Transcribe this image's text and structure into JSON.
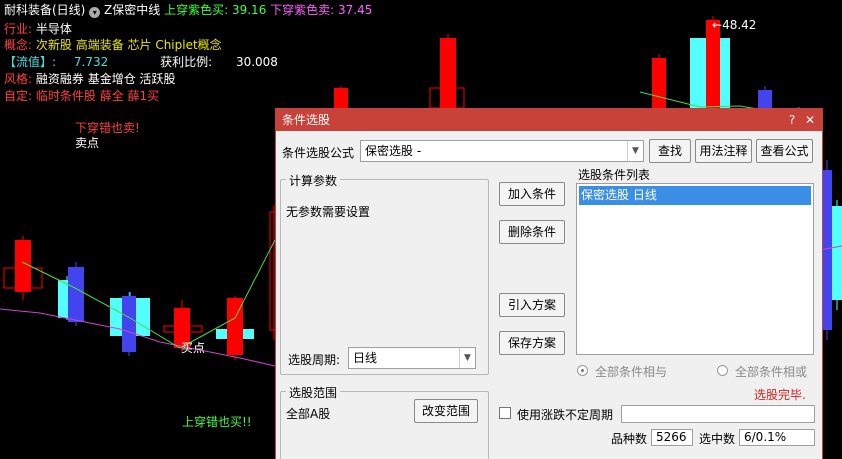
{
  "header": {
    "stock_name": "耐科装备(日线)",
    "indicator_icon": "dropdown-circle-icon",
    "indicator_name": "Z保密中线",
    "buy_label": "上穿紫色买:",
    "buy_value": "39.16",
    "sell_label": "下穿紫色卖:",
    "sell_value": "37.45"
  },
  "info": {
    "industry_label": "行业:",
    "industry_value": "半导体",
    "concept_label": "概念:",
    "concept_value": "次新股 高端装备 芯片 Chiplet概念",
    "float_label": "【流值】:",
    "float_value": "7.732",
    "profit_label": "获利比例:",
    "profit_value": "30.008",
    "style_label": "风格:",
    "style_value": "融资融券 基金增仓 活跃股",
    "custom_label": "自定:",
    "custom_value": "临时条件股 薛全 薛1买"
  },
  "chart_annotations": {
    "sell_signal_text": "下穿错也卖!",
    "sell_point_text": "卖点",
    "buy_point_text": "买点",
    "buy_signal_text": "上穿错也买!!",
    "high_price_label": "48.42"
  },
  "colors": {
    "up": "#ff0000",
    "down": "#54ffff",
    "purple_line": "#cc44cc",
    "green_line": "#44dd44",
    "dialog_title": "#c8423a",
    "selection": "#3a8ee6",
    "done_text": "#d42020"
  },
  "dialog": {
    "title": "条件选股",
    "help_icon": "question-icon",
    "close_icon": "close-icon",
    "formula_label": "条件选股公式",
    "formula_value": "保密选股 -",
    "find_button": "查找",
    "usage_button": "用法注释",
    "view_formula_button": "查看公式",
    "params_group_title": "计算参数",
    "params_text": "无参数需要设置",
    "period_label": "选股周期:",
    "period_value": "日线",
    "range_group_title": "选股范围",
    "range_value": "全部A股",
    "change_range_button": "改变范围",
    "add_condition_button": "加入条件",
    "delete_condition_button": "删除条件",
    "import_scheme_button": "引入方案",
    "save_scheme_button": "保存方案",
    "condition_list_label": "选股条件列表",
    "conditions": [
      "保密选股  日线"
    ],
    "radio_and": "全部条件相与",
    "radio_or": "全部条件相或",
    "done_text": "选股完毕.",
    "use_change_period_label": "使用涨跌不定周期",
    "stock_count_label": "品种数",
    "stock_count_value": "5266",
    "selected_label": "选中数",
    "selected_value": "6/0.1%"
  }
}
